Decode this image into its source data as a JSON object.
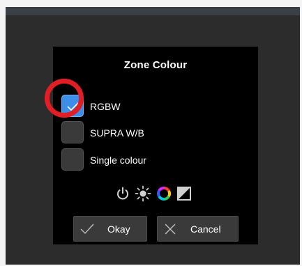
{
  "dialog": {
    "title": "Zone Colour",
    "options": [
      {
        "label": "RGBW",
        "checked": true
      },
      {
        "label": "SUPRA W/B",
        "checked": false
      },
      {
        "label": "Single colour",
        "checked": false
      }
    ],
    "icons": [
      "power-icon",
      "brightness-icon",
      "color-wheel-icon",
      "contrast-icon"
    ],
    "okay_label": "Okay",
    "cancel_label": "Cancel"
  },
  "colors": {
    "accent": "#3d8ee8",
    "annotation": "#e01e24",
    "dialog_bg": "#000000"
  }
}
